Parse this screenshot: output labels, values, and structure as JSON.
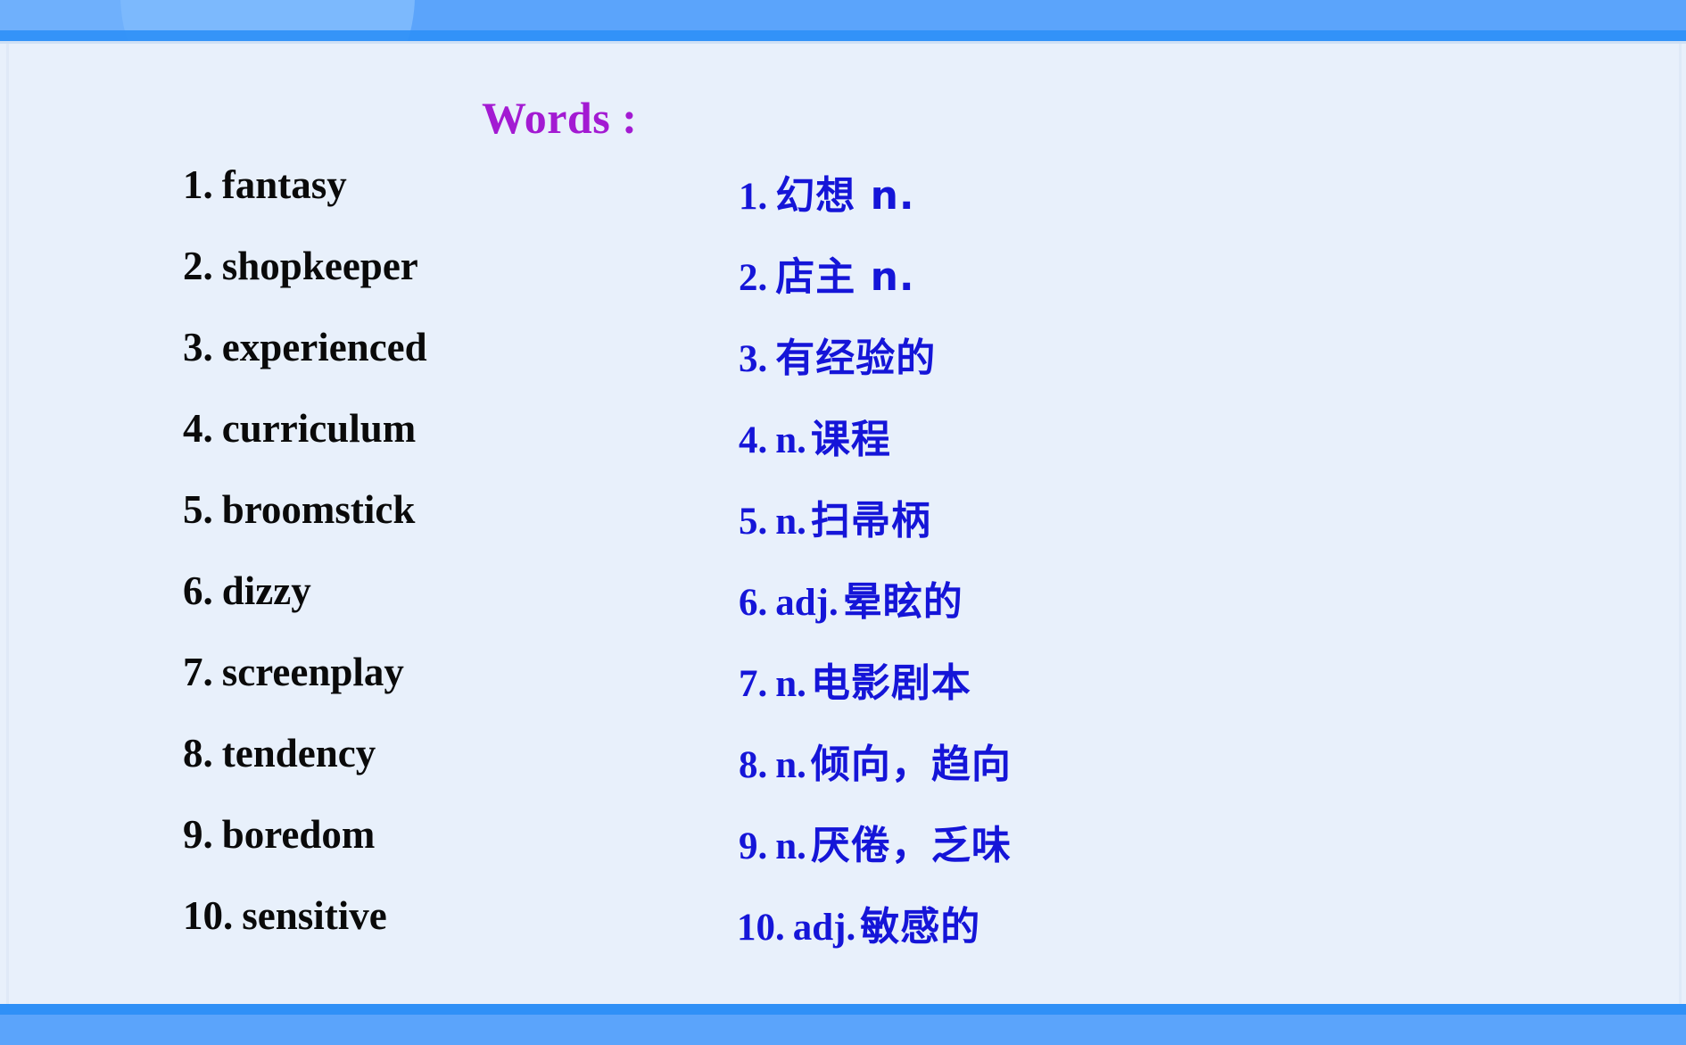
{
  "slide": {
    "title": "Words :",
    "title_color": "#a31ad2",
    "background_color": "#e8f0fb",
    "band_color": "#5ba4fb",
    "band_rule_color": "#2f90f7",
    "english_color": "#0a0a0a",
    "chinese_color": "#1515d8"
  },
  "vocabulary": [
    {
      "index": "1.",
      "english": "fantasy",
      "cn_index": "1.",
      "pos": "",
      "chinese": "幻想 n.",
      "chinese_full": "1. 幻想 n."
    },
    {
      "index": "2.",
      "english": "shopkeeper",
      "cn_index": "2.",
      "pos": "",
      "chinese": "店主 n.",
      "chinese_full": "2.  店主 n."
    },
    {
      "index": "3.",
      "english": "experienced",
      "cn_index": "3.",
      "pos": "",
      "chinese": "有经验的",
      "chinese_full": "3. 有经验的"
    },
    {
      "index": "4.",
      "english": "curriculum",
      "cn_index": "4.",
      "pos": "n.",
      "chinese": "课程",
      "chinese_full": "4. n. 课程"
    },
    {
      "index": "5.",
      "english": "broomstick",
      "cn_index": "5.",
      "pos": "n.",
      "chinese": "扫帚柄",
      "chinese_full": "5. n. 扫帚柄"
    },
    {
      "index": "6.",
      "english": "dizzy",
      "cn_index": "6.",
      "pos": "adj.",
      "chinese": "晕眩的",
      "chinese_full": "6. adj. 晕眩的"
    },
    {
      "index": "7.",
      "english": "screenplay",
      "cn_index": "7.",
      "pos": "n.",
      "chinese": "电影剧本",
      "chinese_full": "7. n. 电影剧本"
    },
    {
      "index": "8.",
      "english": "tendency",
      "cn_index": "8.",
      "pos": "n.",
      "chinese": "倾向，趋向",
      "chinese_full": "8. n. 倾向，趋向"
    },
    {
      "index": "9.",
      "english": "boredom",
      "cn_index": "9.",
      "pos": "n.",
      "chinese": "厌倦，乏味",
      "chinese_full": "9. n. 厌倦，乏味"
    },
    {
      "index": "10.",
      "english": "sensitive",
      "cn_index": "10.",
      "pos": "adj.",
      "chinese": "敏感的",
      "chinese_full": "10. adj. 敏感的"
    }
  ]
}
